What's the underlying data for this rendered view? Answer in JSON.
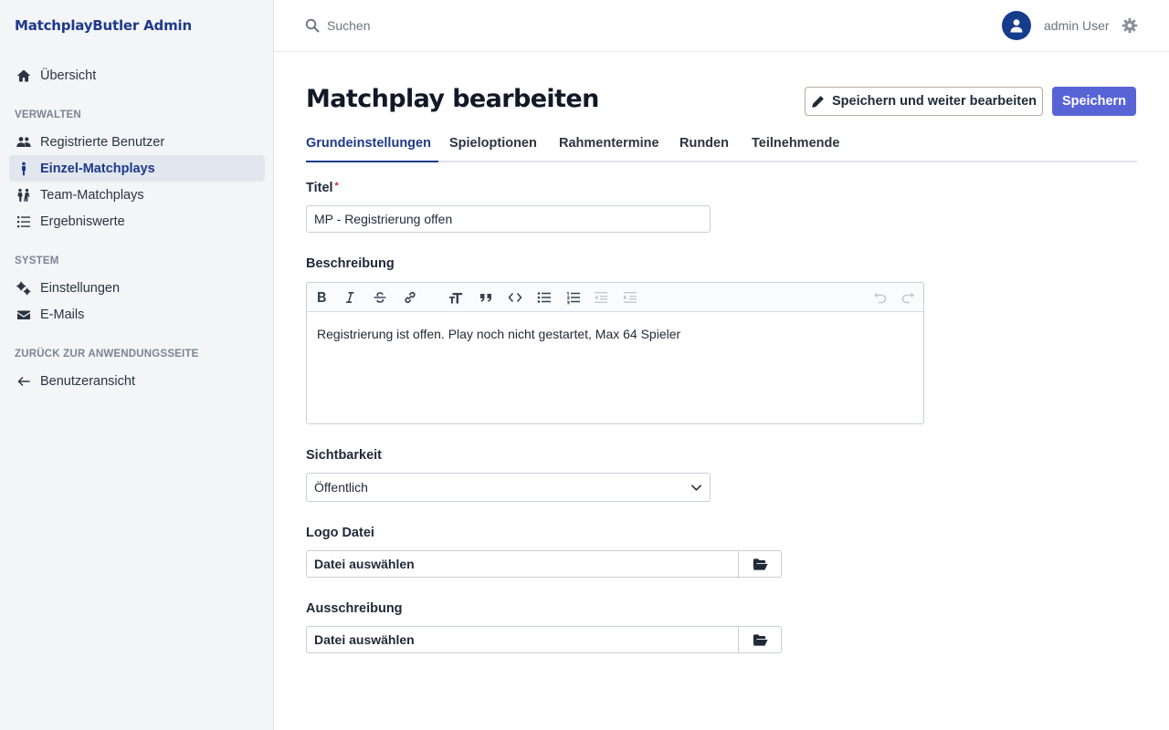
{
  "sidebar": {
    "brand": "MatchplayButler Admin",
    "overview": "Übersicht",
    "sections": {
      "manage": "VERWALTEN",
      "system": "SYSTEM",
      "back": "ZURÜCK ZUR ANWENDUNGSSEITE"
    },
    "items": {
      "users": "Registrierte Benutzer",
      "single": "Einzel-Matchplays",
      "team": "Team-Matchplays",
      "results": "Ergebniswerte",
      "settings": "Einstellungen",
      "emails": "E-Mails",
      "userview": "Benutzeransicht"
    },
    "active_item": "Einzel-Matchplays"
  },
  "topbar": {
    "search_placeholder": "Suchen",
    "user_name": "admin User"
  },
  "page": {
    "title": "Matchplay bearbeiten",
    "save_continue_label": "Speichern und weiter bearbeiten",
    "save_label": "Speichern"
  },
  "tabs": [
    "Grundeinstellungen",
    "Spieloptionen",
    "Rahmentermine",
    "Runden",
    "Teilnehmende"
  ],
  "active_tab": "Grundeinstellungen",
  "form": {
    "title_label": "Titel",
    "title_required_mark": "*",
    "title_value": "MP - Registrierung offen",
    "description_label": "Beschreibung",
    "description_value": "Registrierung ist offen. Play noch nicht gestartet, Max 64 Spieler",
    "visibility_label": "Sichtbarkeit",
    "visibility_value": "Öffentlich",
    "logo_label": "Logo Datei",
    "logo_button": "Datei auswählen",
    "tender_label": "Ausschreibung",
    "tender_button": "Datei auswählen"
  },
  "colors": {
    "brand": "#1d3a8a",
    "primary_button": "#5864d6",
    "avatar": "#163c8c",
    "required": "#dc2626"
  }
}
